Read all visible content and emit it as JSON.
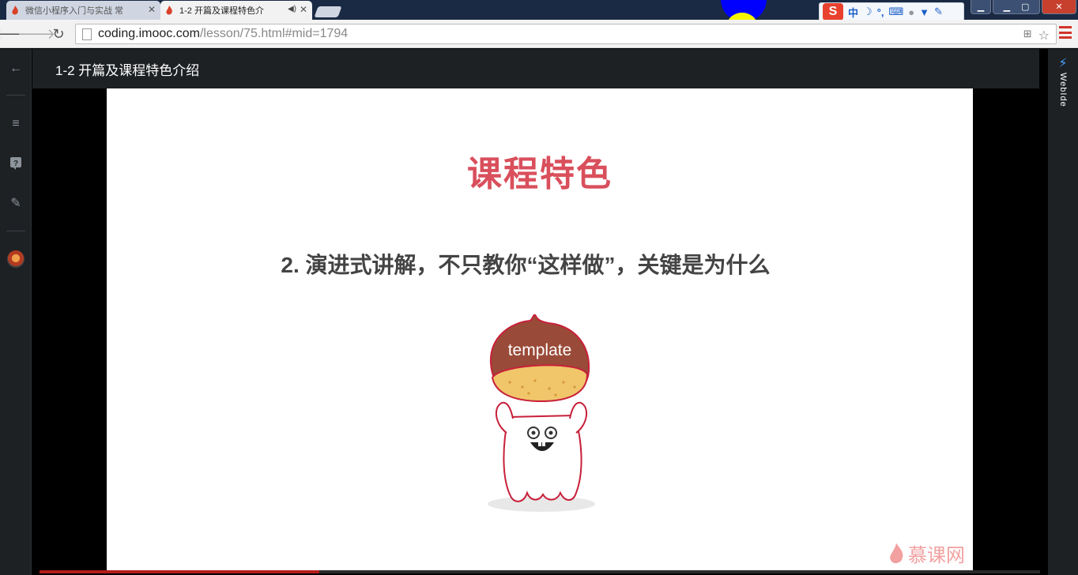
{
  "tabs": [
    {
      "title": "微信小程序入门与实战 常",
      "active": false
    },
    {
      "title": "1-2 开篇及课程特色介",
      "active": true
    }
  ],
  "ime": {
    "lang": "中"
  },
  "toolbar": {
    "url_host": "coding.imooc.com",
    "url_path": "/lesson/75.html#mid=1794"
  },
  "lesson": {
    "title": "1-2 开篇及课程特色介绍"
  },
  "slide": {
    "title": "课程特色",
    "subtitle": "2. 演进式讲解，不只教你“这样做”，关键是为什么",
    "mascot_label": "template",
    "watermark": "慕课网"
  },
  "video": {
    "progress_fraction": 0.28
  },
  "sidebar_right": {
    "label": "WebIde"
  },
  "colors": {
    "accent": "#d94f5c",
    "header": "#1e2124",
    "brand": "#b31c1c"
  }
}
